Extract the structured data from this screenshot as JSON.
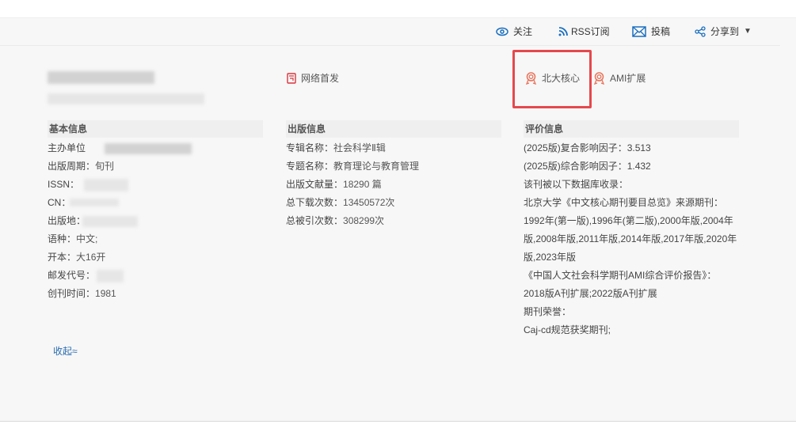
{
  "toolbar": {
    "follow": "关注",
    "rss": "RSS订阅",
    "submit": "投稿",
    "share": "分享到"
  },
  "tags": {
    "online_first": "网络首发",
    "pku_core": "北大核心",
    "ami": "AMI扩展"
  },
  "basic": {
    "title": "基本信息",
    "rows": [
      {
        "label": "主办单位"
      },
      {
        "label": "出版周期：",
        "value": "旬刊"
      },
      {
        "label": "ISSN："
      },
      {
        "label": "CN："
      },
      {
        "label": "出版地："
      },
      {
        "label": "语种：",
        "value": "中文;"
      },
      {
        "label": "开本：",
        "value": "大16开"
      },
      {
        "label": "邮发代号："
      },
      {
        "label": "创刊时间：",
        "value": "1981"
      }
    ]
  },
  "publish": {
    "title": "出版信息",
    "rows": [
      {
        "label": "专辑名称：",
        "value": "社会科学Ⅱ辑"
      },
      {
        "label": "专题名称：",
        "value": "教育理论与教育管理"
      },
      {
        "label": "出版文献量：",
        "value": "18290 篇"
      },
      {
        "label": "总下载次数：",
        "value": "13450572次"
      },
      {
        "label": "总被引次数：",
        "value": "308299次"
      }
    ]
  },
  "evaluation": {
    "title": "评价信息",
    "lines": [
      "(2025版)复合影响因子：3.513",
      "(2025版)综合影响因子：1.432",
      "该刊被以下数据库收录：",
      "北京大学《中文核心期刊要目总览》来源期刊：",
      "1992年(第一版),1996年(第二版),2000年版,2004年",
      "版,2008年版,2011年版,2014年版,2017年版,2020年",
      "版,2023年版",
      "《中国人文社会科学期刊AMI综合评价报告》：",
      "2018版A刊扩展;2022版A刊扩展",
      "期刊荣誉：",
      "Caj-cd规范获奖期刊;"
    ]
  },
  "collapse": "收起≈",
  "colors": {
    "link": "#1a5fa8",
    "highlight": "#e5484d",
    "badge": "#e8735a"
  }
}
